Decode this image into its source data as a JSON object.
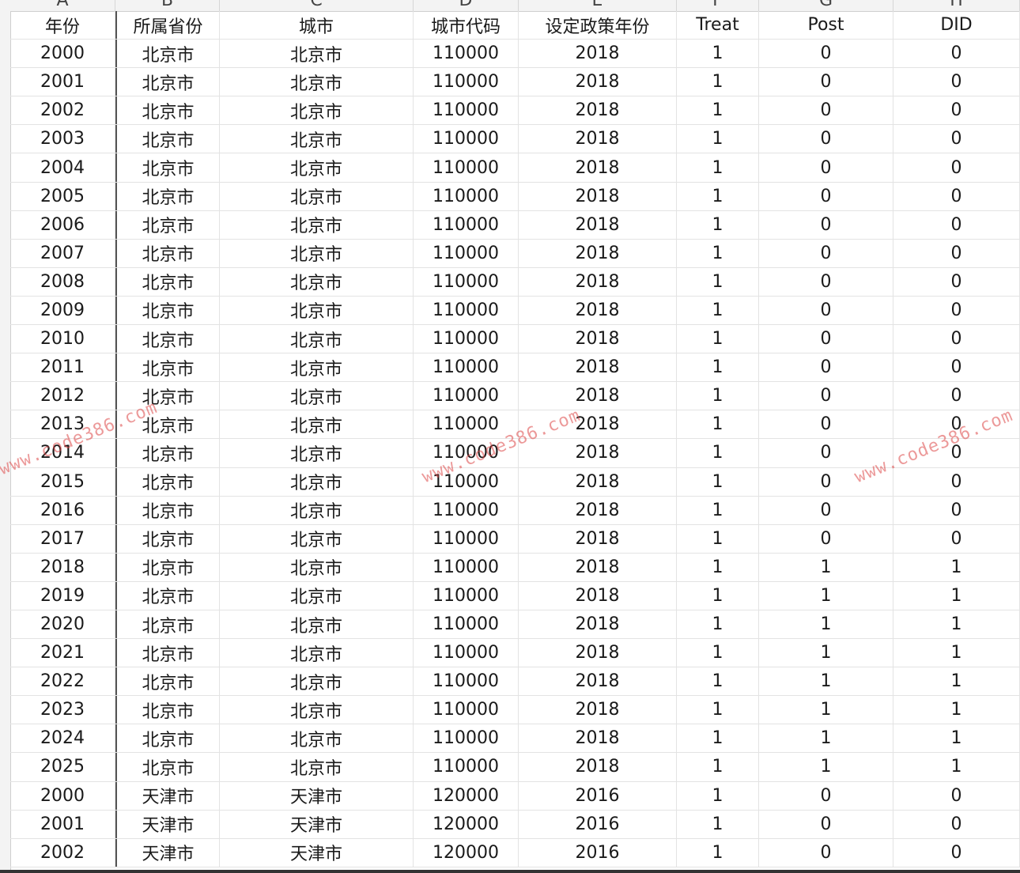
{
  "column_letters": [
    "A",
    "B",
    "C",
    "D",
    "E",
    "F",
    "G",
    "H"
  ],
  "headers": [
    "年份",
    "所属省份",
    "城市",
    "城市代码",
    "设定政策年份",
    "Treat",
    "Post",
    "DID"
  ],
  "rows": [
    [
      "2000",
      "北京市",
      "北京市",
      "110000",
      "2018",
      "1",
      "0",
      "0"
    ],
    [
      "2001",
      "北京市",
      "北京市",
      "110000",
      "2018",
      "1",
      "0",
      "0"
    ],
    [
      "2002",
      "北京市",
      "北京市",
      "110000",
      "2018",
      "1",
      "0",
      "0"
    ],
    [
      "2003",
      "北京市",
      "北京市",
      "110000",
      "2018",
      "1",
      "0",
      "0"
    ],
    [
      "2004",
      "北京市",
      "北京市",
      "110000",
      "2018",
      "1",
      "0",
      "0"
    ],
    [
      "2005",
      "北京市",
      "北京市",
      "110000",
      "2018",
      "1",
      "0",
      "0"
    ],
    [
      "2006",
      "北京市",
      "北京市",
      "110000",
      "2018",
      "1",
      "0",
      "0"
    ],
    [
      "2007",
      "北京市",
      "北京市",
      "110000",
      "2018",
      "1",
      "0",
      "0"
    ],
    [
      "2008",
      "北京市",
      "北京市",
      "110000",
      "2018",
      "1",
      "0",
      "0"
    ],
    [
      "2009",
      "北京市",
      "北京市",
      "110000",
      "2018",
      "1",
      "0",
      "0"
    ],
    [
      "2010",
      "北京市",
      "北京市",
      "110000",
      "2018",
      "1",
      "0",
      "0"
    ],
    [
      "2011",
      "北京市",
      "北京市",
      "110000",
      "2018",
      "1",
      "0",
      "0"
    ],
    [
      "2012",
      "北京市",
      "北京市",
      "110000",
      "2018",
      "1",
      "0",
      "0"
    ],
    [
      "2013",
      "北京市",
      "北京市",
      "110000",
      "2018",
      "1",
      "0",
      "0"
    ],
    [
      "2014",
      "北京市",
      "北京市",
      "110000",
      "2018",
      "1",
      "0",
      "0"
    ],
    [
      "2015",
      "北京市",
      "北京市",
      "110000",
      "2018",
      "1",
      "0",
      "0"
    ],
    [
      "2016",
      "北京市",
      "北京市",
      "110000",
      "2018",
      "1",
      "0",
      "0"
    ],
    [
      "2017",
      "北京市",
      "北京市",
      "110000",
      "2018",
      "1",
      "0",
      "0"
    ],
    [
      "2018",
      "北京市",
      "北京市",
      "110000",
      "2018",
      "1",
      "1",
      "1"
    ],
    [
      "2019",
      "北京市",
      "北京市",
      "110000",
      "2018",
      "1",
      "1",
      "1"
    ],
    [
      "2020",
      "北京市",
      "北京市",
      "110000",
      "2018",
      "1",
      "1",
      "1"
    ],
    [
      "2021",
      "北京市",
      "北京市",
      "110000",
      "2018",
      "1",
      "1",
      "1"
    ],
    [
      "2022",
      "北京市",
      "北京市",
      "110000",
      "2018",
      "1",
      "1",
      "1"
    ],
    [
      "2023",
      "北京市",
      "北京市",
      "110000",
      "2018",
      "1",
      "1",
      "1"
    ],
    [
      "2024",
      "北京市",
      "北京市",
      "110000",
      "2018",
      "1",
      "1",
      "1"
    ],
    [
      "2025",
      "北京市",
      "北京市",
      "110000",
      "2018",
      "1",
      "1",
      "1"
    ],
    [
      "2000",
      "天津市",
      "天津市",
      "120000",
      "2016",
      "1",
      "0",
      "0"
    ],
    [
      "2001",
      "天津市",
      "天津市",
      "120000",
      "2016",
      "1",
      "0",
      "0"
    ],
    [
      "2002",
      "天津市",
      "天津市",
      "120000",
      "2016",
      "1",
      "0",
      "0"
    ]
  ],
  "watermarks": [
    "www.code386.com",
    "www.code386.com",
    "www.code386.com"
  ],
  "colors": {
    "watermark": "#dc4646",
    "grid_line": "#e3e3e3",
    "header_bg": "#f3f3f3"
  }
}
